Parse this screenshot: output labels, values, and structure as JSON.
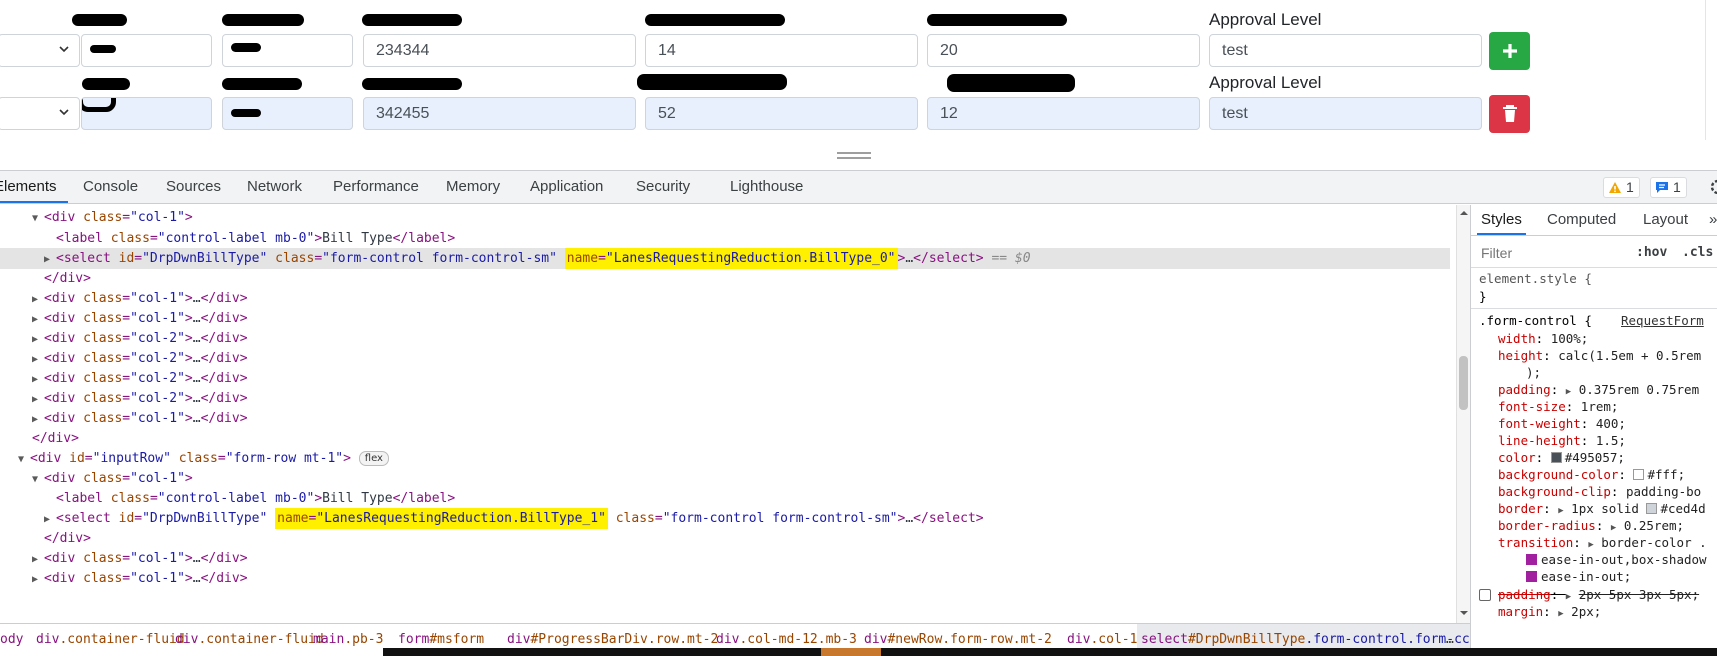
{
  "form": {
    "labels": {
      "approval_level": "Approval Level"
    },
    "rows": [
      {
        "requested": "234344",
        "rate_sgd": "14",
        "rate_2": "20",
        "approval": "test",
        "action": "add"
      },
      {
        "requested": "342455",
        "rate_sgd": "52",
        "rate_2": "12",
        "approval": "test",
        "action": "delete"
      }
    ]
  },
  "devtools": {
    "tabs": [
      "Elements",
      "Console",
      "Sources",
      "Network",
      "Performance",
      "Memory",
      "Application",
      "Security",
      "Lighthouse"
    ],
    "warnings": "1",
    "messages": "1",
    "elements": {
      "l0": {
        "tag": "div",
        "attr": "class",
        "val": "\"col-1\""
      },
      "l1": {
        "tag": "label",
        "a1": "class",
        "v1": "\"control-label mb-0\"",
        "text": "Bill Type",
        "close": "label"
      },
      "l2": {
        "id_attr": "id",
        "id_val": "\"DrpDwnBillType\"",
        "class_attr": "class",
        "class_val": "\"form-control form-control-sm\"",
        "name_attr": "name",
        "name_val": "\"LanesRequestingReduction.BillType_0\"",
        "ellipsis": "…",
        "close": "select",
        "dollar": "== $0"
      },
      "col1": "\"col-1\"",
      "col2": "\"col-2\"",
      "ellipsis": "…",
      "row_id": "\"inputRow\"",
      "row_class": "\"form-row mt-1\"",
      "flex": "flex",
      "l16": {
        "id_val": "\"DrpDwnBillType\"",
        "name_val": "\"LanesRequestingReduction.BillType_1\"",
        "class_val": "\"form-control form-control-sm\""
      }
    },
    "breadcrumbs": [
      {
        "tag": "ody",
        "rest": ""
      },
      {
        "tag": "div",
        "rest": ".container-fluid"
      },
      {
        "tag": "div",
        "rest": ".container-fluid"
      },
      {
        "tag": "main",
        "rest": ".pb-3"
      },
      {
        "tag": "form",
        "rest": "#msform"
      },
      {
        "tag": "div",
        "rest": "#ProgressBarDiv.row.mt-2"
      },
      {
        "tag": "div",
        "rest": ".col-md-12.mb-3"
      },
      {
        "tag": "div",
        "rest": "#newRow.form-row.mt-2"
      },
      {
        "tag": "div",
        "rest": ".col-1"
      },
      {
        "tag": "select",
        "rest": "#DrpDwnBillType",
        "cls": ".form-control.form-cc"
      }
    ],
    "crumb_more": "…",
    "styles": {
      "tabs": [
        "Styles",
        "Computed",
        "Layout"
      ],
      "more": "»",
      "filter_placeholder": "Filter",
      "hov": ":hov",
      "cls": ".cls",
      "element_style": "element.style {",
      "close_brace": "}",
      "rule_selector": ".form-control {",
      "rule_source": "RequestForm",
      "props": [
        {
          "name": "width",
          "value": "100%;"
        },
        {
          "name": "height",
          "value": "calc(1.5em + 0.5rem"
        },
        {
          "name": "",
          "value": ");"
        },
        {
          "name": "padding",
          "value": "0.375rem 0.75rem"
        },
        {
          "name": "font-size",
          "value": "1rem;"
        },
        {
          "name": "font-weight",
          "value": "400;"
        },
        {
          "name": "line-height",
          "value": "1.5;"
        },
        {
          "name": "color",
          "value": "#495057;"
        },
        {
          "name": "background-color",
          "value": "#fff;"
        },
        {
          "name": "background-clip",
          "value": "padding-bo"
        },
        {
          "name": "border",
          "value": "1px solid"
        },
        {
          "name": "border-radius",
          "value": "0.25rem;"
        },
        {
          "name": "transition",
          "value": "border-color ."
        },
        {
          "name": "",
          "value": "ease-in-out,box-shadow"
        },
        {
          "name": "",
          "value": "ease-in-out;"
        }
      ],
      "border_color_val": "#ced4d",
      "padding_strike": "padding",
      "padding_strike_val": "2px 5px 3px 5px;",
      "margin_name": "margin",
      "margin_val": "2px;"
    }
  },
  "colors": {
    "add_button": "#28a745",
    "delete_button": "#dc3545",
    "autofill": "#e8f0fe",
    "highlight": "#fff000",
    "accent": "#1a73e8"
  }
}
